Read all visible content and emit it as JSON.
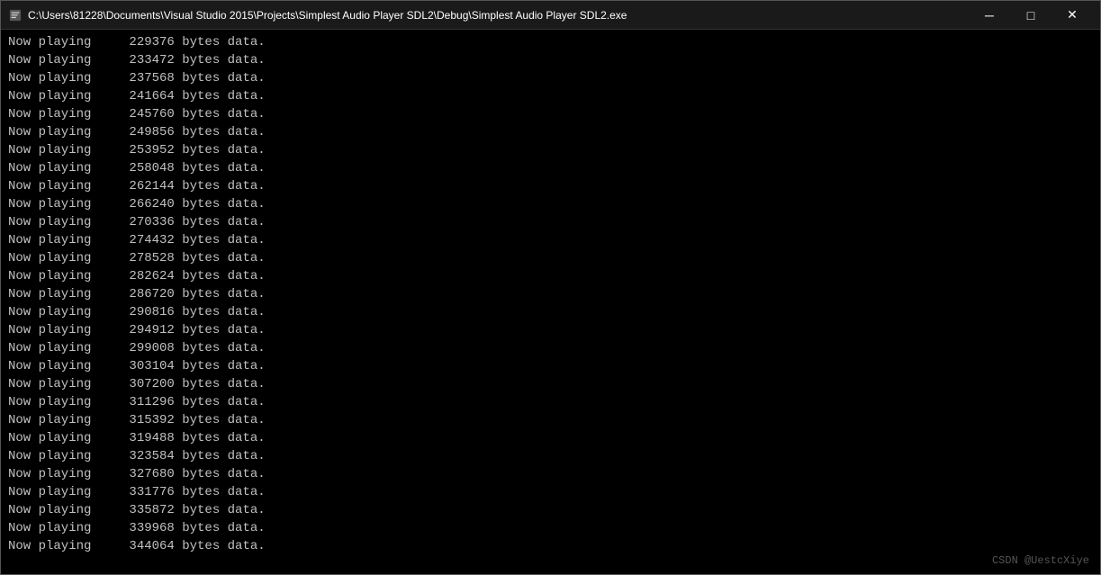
{
  "titleBar": {
    "title": "C:\\Users\\81228\\Documents\\Visual Studio 2015\\Projects\\Simplest Audio Player SDL2\\Debug\\Simplest Audio Player SDL2.exe",
    "minimizeLabel": "─",
    "maximizeLabel": "□",
    "closeLabel": "✕"
  },
  "console": {
    "lines": [
      "Now playing\t229376 bytes data.",
      "Now playing\t233472 bytes data.",
      "Now playing\t237568 bytes data.",
      "Now playing\t241664 bytes data.",
      "Now playing\t245760 bytes data.",
      "Now playing\t249856 bytes data.",
      "Now playing\t253952 bytes data.",
      "Now playing\t258048 bytes data.",
      "Now playing\t262144 bytes data.",
      "Now playing\t266240 bytes data.",
      "Now playing\t270336 bytes data.",
      "Now playing\t274432 bytes data.",
      "Now playing\t278528 bytes data.",
      "Now playing\t282624 bytes data.",
      "Now playing\t286720 bytes data.",
      "Now playing\t290816 bytes data.",
      "Now playing\t294912 bytes data.",
      "Now playing\t299008 bytes data.",
      "Now playing\t303104 bytes data.",
      "Now playing\t307200 bytes data.",
      "Now playing\t311296 bytes data.",
      "Now playing\t315392 bytes data.",
      "Now playing\t319488 bytes data.",
      "Now playing\t323584 bytes data.",
      "Now playing\t327680 bytes data.",
      "Now playing\t331776 bytes data.",
      "Now playing\t335872 bytes data.",
      "Now playing\t339968 bytes data.",
      "Now playing\t344064 bytes data."
    ]
  },
  "watermark": "CSDN @UestcXiye"
}
